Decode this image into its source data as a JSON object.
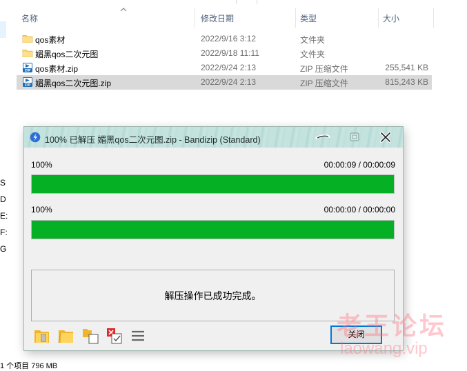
{
  "explorer": {
    "columns": {
      "name": "名称",
      "date": "修改日期",
      "type": "类型",
      "size": "大小"
    },
    "files": [
      {
        "name": "qos素材",
        "date": "2022/9/16 3:12",
        "type": "文件夹",
        "size": "",
        "icon": "folder-icon",
        "selected": false
      },
      {
        "name": "媚黑qos二次元图",
        "date": "2022/9/18 11:11",
        "type": "文件夹",
        "size": "",
        "icon": "folder-icon",
        "selected": false
      },
      {
        "name": "qos素材.zip",
        "date": "2022/9/24 2:13",
        "type": "ZIP 压缩文件",
        "size": "255,541 KB",
        "icon": "zip-file-icon",
        "selected": false
      },
      {
        "name": "媚黑qos二次元图.zip",
        "date": "2022/9/24 2:13",
        "type": "ZIP 压缩文件",
        "size": "815,243 KB",
        "icon": "zip-file-icon",
        "selected": true
      }
    ],
    "nav_letters": [
      "S",
      "D",
      "E:",
      "F:",
      "G"
    ],
    "status": "1 个项目 796 MB"
  },
  "dialog": {
    "title": "100% 已解压 媚黑qos二次元图.zip - Bandizip (Standard)",
    "progress": [
      {
        "label": "100%",
        "time": "00:00:09 / 00:00:09",
        "fraction": 1.0
      },
      {
        "label": "100%",
        "time": "00:00:00 / 00:00:00",
        "fraction": 1.0
      }
    ],
    "message": "解压操作已成功完成。",
    "close_label": "关闭",
    "colors": {
      "progress": "#06b025",
      "titlebar": "#c4e3df",
      "focus": "#0078d7"
    }
  },
  "watermark": {
    "line1": "老王论坛",
    "line2": "laowang.vip"
  }
}
